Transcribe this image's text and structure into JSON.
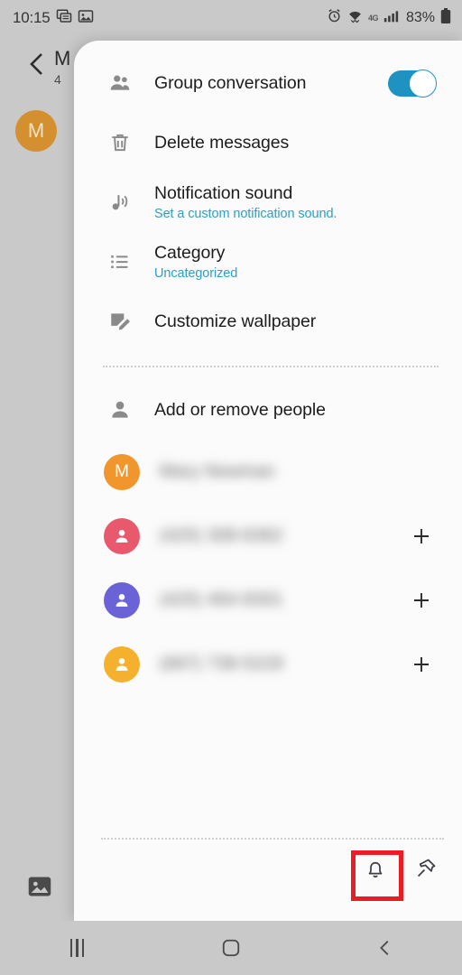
{
  "status_bar": {
    "time": "10:15",
    "left_icons": [
      "messages-icon",
      "gallery-icon"
    ],
    "alarm_icon": "alarm-icon",
    "wifi_icon": "wifi-icon",
    "network_label": "4G",
    "signal_icon": "signal-bars-icon",
    "battery_percent": "83%",
    "battery_icon": "battery-icon"
  },
  "background": {
    "back_icon": "back-chevron-icon",
    "title": "M",
    "subtitle": "4",
    "avatar_initial": "M",
    "avatar_color": "#D4902F",
    "attachment_icon": "image-icon"
  },
  "sheet": {
    "menu": [
      {
        "name": "group-conversation",
        "icon": "people-icon",
        "title": "Group conversation",
        "subtitle": "",
        "control": "toggle",
        "toggle_on": true
      },
      {
        "name": "delete-messages",
        "icon": "trash-icon",
        "title": "Delete messages",
        "subtitle": "",
        "control": "none"
      },
      {
        "name": "notification-sound",
        "icon": "music-note-icon",
        "title": "Notification sound",
        "subtitle": "Set a custom notification sound.",
        "control": "none"
      },
      {
        "name": "category",
        "icon": "list-icon",
        "title": "Category",
        "subtitle": "Uncategorized",
        "control": "none"
      },
      {
        "name": "customize-wallpaper",
        "icon": "wallpaper-edit-icon",
        "title": "Customize wallpaper",
        "subtitle": "",
        "control": "none"
      }
    ],
    "people_header": {
      "icon": "person-icon",
      "title": "Add or remove people"
    },
    "people": [
      {
        "name": "Mary Newman",
        "redacted": true,
        "avatar_type": "initial",
        "avatar_initial": "M",
        "avatar_color": "#F0962C",
        "action": "none"
      },
      {
        "name": "(425) 308-6362",
        "redacted": true,
        "avatar_type": "person",
        "avatar_initial": "",
        "avatar_color": "#E8596E",
        "action": "add"
      },
      {
        "name": "(425) 464-8301",
        "redacted": true,
        "avatar_type": "person",
        "avatar_initial": "",
        "avatar_color": "#6A63D8",
        "action": "add"
      },
      {
        "name": "(667) 738-5229",
        "redacted": true,
        "avatar_type": "person",
        "avatar_initial": "",
        "avatar_color": "#F5B02E",
        "action": "add"
      }
    ],
    "footer": {
      "notification_icon": "bell-icon",
      "pin_icon": "pin-icon",
      "add_icon": "plus-icon"
    }
  },
  "annotation": {
    "highlight_color": "#ec1c24",
    "highlight_target": "bell-icon"
  },
  "nav_bar": {
    "recents_icon": "recents-icon",
    "home_icon": "home-icon",
    "back_icon": "back-icon"
  }
}
